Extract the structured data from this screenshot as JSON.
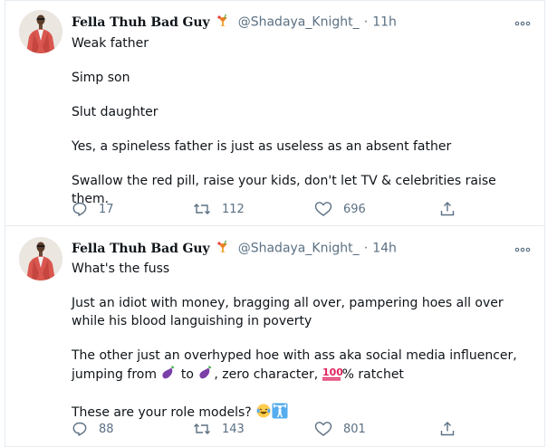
{
  "tweets": [
    {
      "author_name": "Fella Thuh Bad Guy",
      "author_emoji": "tropical-drink-icon",
      "handle": "@Shadaya_Knight_",
      "separator": "·",
      "time": "11h",
      "paragraphs": [
        "Weak father",
        "Simp son",
        "Slut daughter",
        "Yes, a spineless father is just as useless as an absent father",
        "Swallow the red pill, raise your kids, don't let TV & celebrities raise them."
      ],
      "reply_count": "17",
      "retweet_count": "112",
      "like_count": "696"
    },
    {
      "author_name": "Fella Thuh Bad Guy",
      "author_emoji": "tropical-drink-icon",
      "handle": "@Shadaya_Knight_",
      "separator": "·",
      "time": "14h",
      "paragraphs": [
        "What's the fuss",
        "Just an idiot with money, bragging all over, pampering hoes all over while his blood languishing in poverty"
      ],
      "line_influencer_a": "The other just an overhyped hoe with ass aka social media influencer,",
      "line_influencer_b1": "jumping from ",
      "line_influencer_b2": " to ",
      "line_influencer_b3": ", zero character, ",
      "line_influencer_b4": "% ratchet",
      "role_models": "These are your role models? ",
      "reply_count": "88",
      "retweet_count": "143",
      "like_count": "801"
    }
  ],
  "colors": {
    "text": "#0f1419",
    "muted": "#5b7083",
    "border": "#e6ecf0"
  }
}
